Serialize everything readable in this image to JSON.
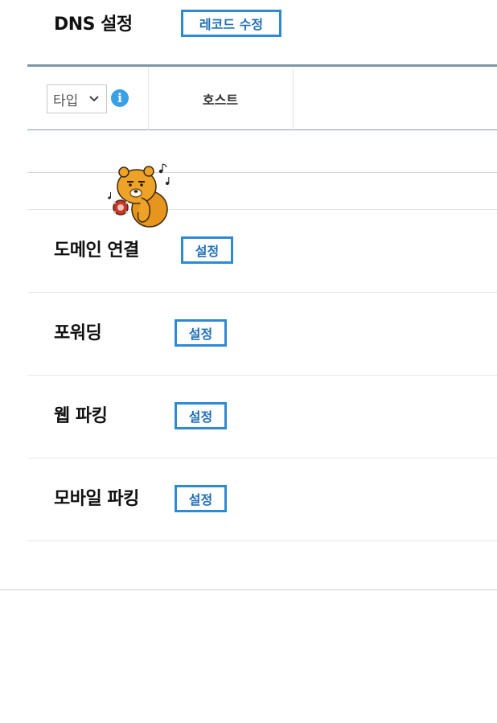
{
  "dns": {
    "title": "DNS 설정",
    "edit_button": "레코드 수정",
    "table": {
      "type_select_value": "타입",
      "info_icon": "i",
      "host_header": "호스트"
    }
  },
  "sections": [
    {
      "title": "도메인 연결",
      "button": "설정"
    },
    {
      "title": "포워딩",
      "button": "설정"
    },
    {
      "title": "웹 파킹",
      "button": "설정"
    },
    {
      "title": "모바일 파킹",
      "button": "설정"
    }
  ],
  "colors": {
    "accent": "#2f8ad4",
    "button_text": "#1f6fb5",
    "info": "#3aa0e6",
    "divider": "#e4e4e4",
    "table_rule": "#7f9aa8"
  },
  "icons": {
    "info": "info-icon",
    "select": "chevron-down-icon",
    "sticker": "bear-character-sticker"
  }
}
